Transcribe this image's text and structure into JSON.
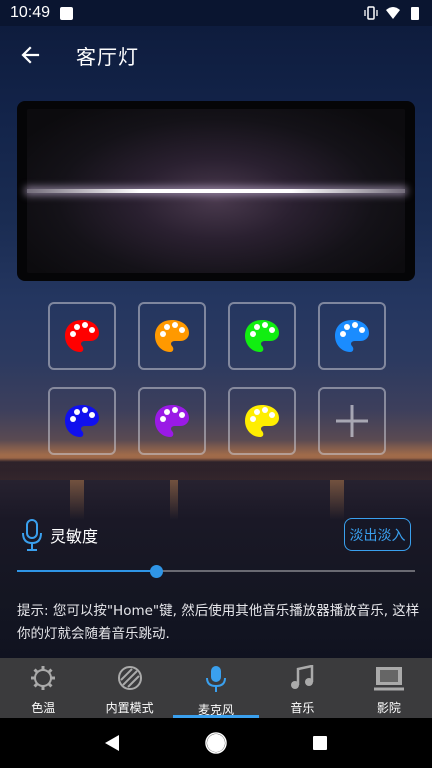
{
  "status_bar": {
    "time": "10:49"
  },
  "app_bar": {
    "title": "客厅灯"
  },
  "preview": {},
  "palette": {
    "colors": [
      "#ff0000",
      "#ff9900",
      "#11ee11",
      "#1a8cff",
      "#1010ee",
      "#9a1ae6",
      "#ffee00"
    ],
    "add_icon": "plus-icon"
  },
  "sensitivity": {
    "label": "灵敏度",
    "fade_button": "淡出淡入",
    "slider_value": 0.35,
    "accent": "#2f95e6"
  },
  "hint": "提示: 您可以按\"Home\"键, 然后使用其他音乐播放器播放音乐, 这样你的灯就会随着音乐跳动.",
  "tabs": [
    {
      "label": "色温",
      "icon": "gear-icon"
    },
    {
      "label": "内置模式",
      "icon": "stripes-icon"
    },
    {
      "label": "麦克风",
      "icon": "mic-icon"
    },
    {
      "label": "音乐",
      "icon": "music-note-icon"
    },
    {
      "label": "影院",
      "icon": "cinema-icon"
    }
  ],
  "active_tab": 2
}
